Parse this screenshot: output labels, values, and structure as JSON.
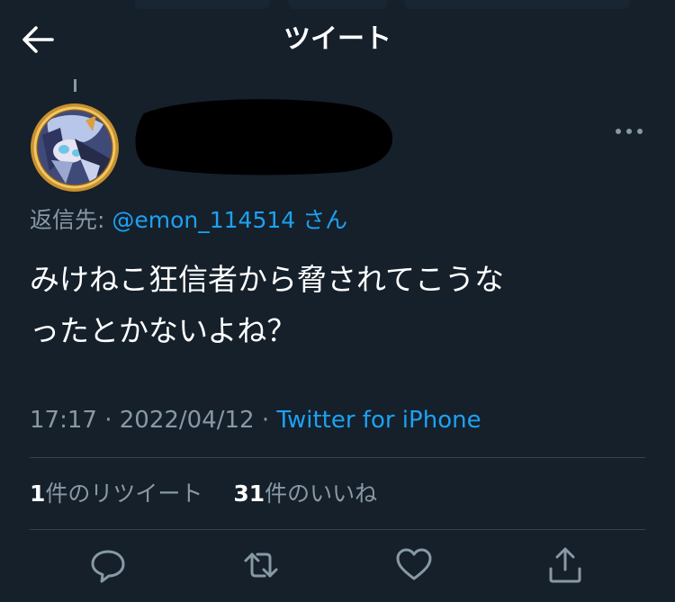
{
  "header": {
    "title": "ツイート",
    "back_icon": "arrow-left-icon"
  },
  "tweet": {
    "author_avatar_icon": "anime-character-avatar",
    "author_name": "",
    "more_icon": "more-horizontal-icon",
    "reply_prefix": "返信先: ",
    "reply_handle": "@emon_114514",
    "reply_suffix": " さん",
    "text_line1": "みけねこ狂信者から脅されてこうな",
    "text_line2": "ったとかないよね？",
    "time": "17:17",
    "date": "2022/04/12",
    "separator": " · ",
    "source": "Twitter for iPhone"
  },
  "stats": {
    "retweet_count": "1",
    "retweet_label": "件のリツイート",
    "like_count": "31",
    "like_label": "件のいいね"
  },
  "actions": {
    "reply_icon": "reply-icon",
    "retweet_icon": "retweet-icon",
    "like_icon": "heart-icon",
    "share_icon": "share-icon"
  },
  "colors": {
    "background": "#15202b",
    "text": "#ffffff",
    "secondary": "#8899a6",
    "accent": "#1da1f2",
    "divider": "#38444d"
  }
}
